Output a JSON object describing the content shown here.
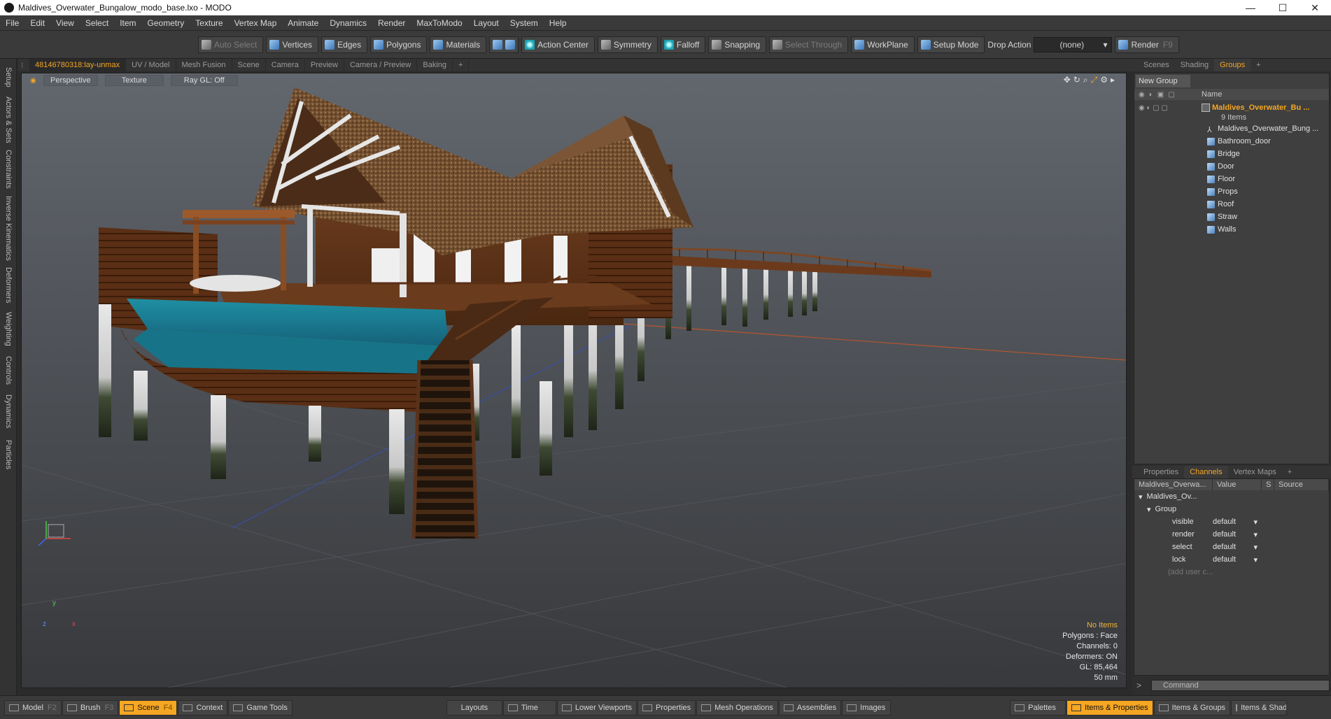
{
  "window": {
    "title": "Maldives_Overwater_Bungalow_modo_base.lxo - MODO",
    "min": "—",
    "max": "☐",
    "close": "✕"
  },
  "menu": [
    "File",
    "Edit",
    "View",
    "Select",
    "Item",
    "Geometry",
    "Texture",
    "Vertex Map",
    "Animate",
    "Dynamics",
    "Render",
    "MaxToModo",
    "Layout",
    "System",
    "Help"
  ],
  "toolbar": {
    "auto_select": "Auto Select",
    "vertices": "Vertices",
    "edges": "Edges",
    "polygons": "Polygons",
    "materials": "Materials",
    "action_center": "Action Center",
    "symmetry": "Symmetry",
    "falloff": "Falloff",
    "snapping": "Snapping",
    "select_through": "Select Through",
    "workplane": "WorkPlane",
    "setup_mode": "Setup Mode",
    "drop_action": "Drop Action",
    "drop_value": "(none)",
    "render": "Render",
    "render_key": "F9"
  },
  "left_tabs": [
    "Setup",
    "Actors & Sets",
    "Constraints",
    "Inverse Kinematics",
    "Deformers",
    "Weighting",
    "Controls",
    "Dynamics",
    "Particles"
  ],
  "viewport_tabs": [
    "48146780318:lay-unmax",
    "UV / Model",
    "Mesh Fusion",
    "Scene",
    "Camera",
    "Preview",
    "Camera / Preview",
    "Baking",
    "+"
  ],
  "viewport": {
    "perspective": "Perspective",
    "texture": "Texture",
    "raygl": "Ray GL: Off",
    "info": {
      "no_items": "No Items",
      "polygons": "Polygons : Face",
      "channels": "Channels: 0",
      "deformers": "Deformers: ON",
      "gl": "GL: 85,464",
      "lens": "50 mm"
    },
    "axis": {
      "x": "x",
      "y": "y",
      "z": "z"
    }
  },
  "right_tabs_top": [
    "Scenes",
    "Shading",
    "Groups",
    "+"
  ],
  "groups": {
    "new_group": "New Group",
    "name_header": "Name",
    "root": "Maldives_Overwater_Bu ...",
    "count": "9 Items",
    "items": [
      "Maldives_Overwater_Bung ...",
      "Bathroom_door",
      "Bridge",
      "Door",
      "Floor",
      "Props",
      "Roof",
      "Straw",
      "Walls"
    ]
  },
  "right_tabs_bottom": [
    "Properties",
    "Channels",
    "Vertex Maps",
    "+"
  ],
  "channels": {
    "headers": [
      "Maldives_Overwa...",
      "Value",
      "S",
      "Source"
    ],
    "root": "Maldives_Ov...",
    "group": "Group",
    "rows": [
      {
        "name": "visible",
        "value": "default"
      },
      {
        "name": "render",
        "value": "default"
      },
      {
        "name": "select",
        "value": "default"
      },
      {
        "name": "lock",
        "value": "default"
      }
    ],
    "add": "(add user c..."
  },
  "command": {
    "prompt": ">",
    "placeholder": "Command"
  },
  "statusbar": {
    "model": "Model",
    "model_key": "F2",
    "brush": "Brush",
    "brush_key": "F3",
    "scene": "Scene",
    "scene_key": "F4",
    "context": "Context",
    "game_tools": "Game Tools",
    "layouts": "Layouts",
    "time": "Time",
    "lower_viewports": "Lower Viewports",
    "properties": "Properties",
    "mesh_operations": "Mesh Operations",
    "assemblies": "Assemblies",
    "images": "Images",
    "palettes": "Palettes",
    "items_properties": "Items & Properties",
    "items_groups": "Items & Groups",
    "items_shading": "Items & Shadin"
  },
  "colors": {
    "accent": "#f5a623",
    "viewport_top": "#5f646b",
    "viewport_bottom": "#3b3c3f"
  }
}
